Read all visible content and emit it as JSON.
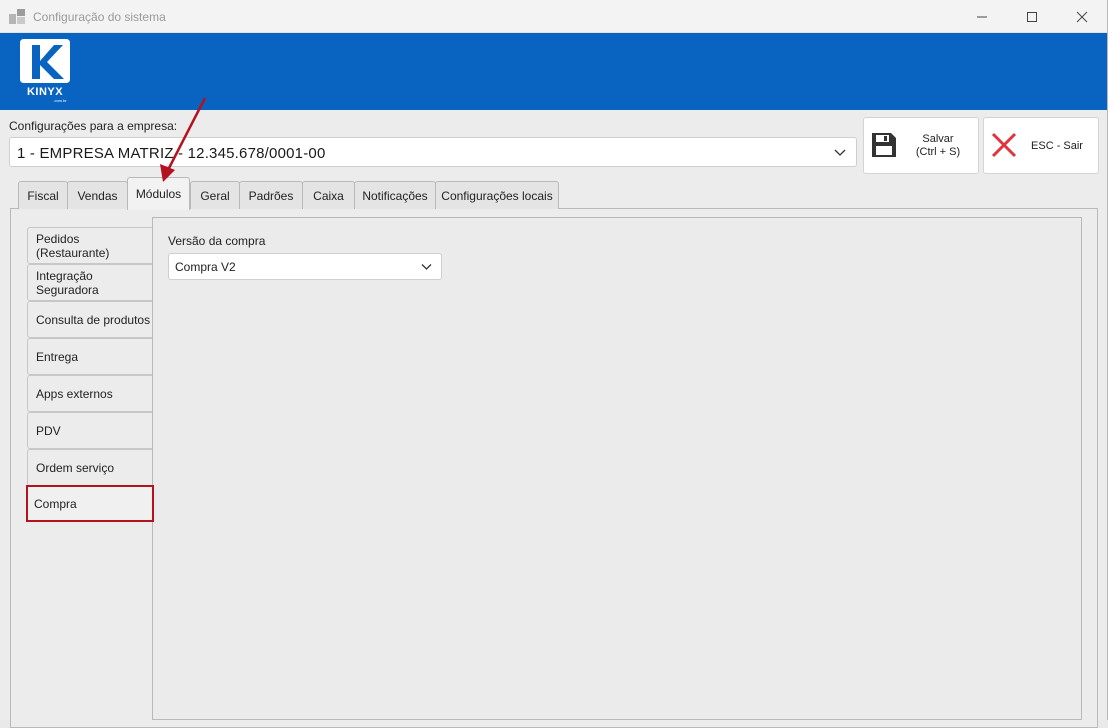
{
  "window": {
    "title": "Configuração do sistema",
    "controls": [
      "minimize-icon",
      "maximize-icon",
      "close-icon"
    ]
  },
  "header": {
    "logo_text": "KINYX",
    "logo_subtext": ".com.br",
    "background_color": "#0963c0"
  },
  "company": {
    "label": "Configurações para a empresa:",
    "selected": "1 - EMPRESA MATRIZ - 12.345.678/0001-00"
  },
  "actions": {
    "save_line1": "Salvar",
    "save_line2": "(Ctrl + S)",
    "exit_label": "ESC - Sair",
    "exit_icon_color": "#e0333b"
  },
  "tabs": [
    {
      "label": "Fiscal"
    },
    {
      "label": "Vendas"
    },
    {
      "label": "Módulos",
      "active": true
    },
    {
      "label": "Geral"
    },
    {
      "label": "Padrões"
    },
    {
      "label": "Caixa"
    },
    {
      "label": "Notificações"
    },
    {
      "label": "Configurações locais"
    }
  ],
  "side_tabs": [
    {
      "label": "Pedidos (Restaurante)"
    },
    {
      "label": "Integração Seguradora"
    },
    {
      "label": "Consulta de produtos"
    },
    {
      "label": "Entrega"
    },
    {
      "label": "Apps externos"
    },
    {
      "label": "PDV"
    },
    {
      "label": "Ordem serviço"
    },
    {
      "label": "Compra",
      "active": true
    }
  ],
  "compra": {
    "version_label": "Versão da compra",
    "version_value": "Compra V2"
  },
  "annotation": {
    "highlight_color": "#b3121f"
  }
}
